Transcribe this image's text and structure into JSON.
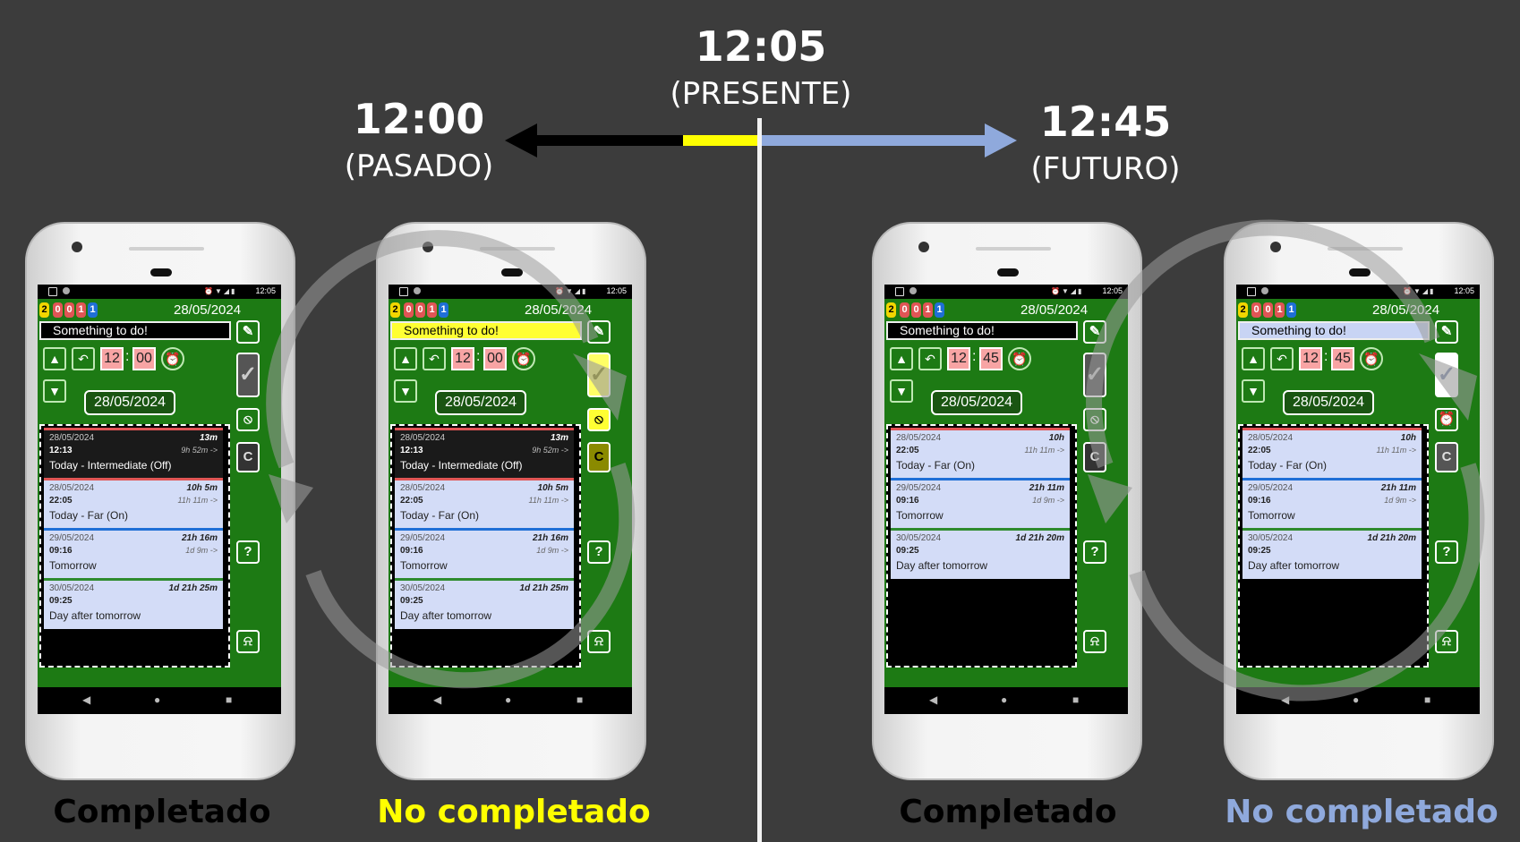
{
  "header": {
    "present_time": "12:05",
    "present_label": "(PRESENTE)",
    "past_time": "12:00",
    "past_label": "(PASADO)",
    "future_time": "12:45",
    "future_label": "(FUTURO)"
  },
  "captions": {
    "c1": "Completado",
    "c2": "No completado",
    "c3": "Completado",
    "c4": "No completado"
  },
  "colors": {
    "background": "#3c3c3c",
    "present_segment": "#ffff00",
    "past_arrow": "#000000",
    "future_arrow": "#8fa9dc",
    "caption_completed": "#000000",
    "caption_past_not_completed": "#ffff00",
    "caption_future_not_completed": "#8fa9dc",
    "app_green": "#1d7a14"
  },
  "status_time": "12:05",
  "badges": [
    "2",
    "0",
    "0",
    "1",
    "1"
  ],
  "header_date": "28/05/2024",
  "task_text": "Something to do!",
  "date_field": "28/05/2024",
  "icons": {
    "up": "arrow-up-icon",
    "undo": "undo-icon",
    "alarm_plus": "alarm-add-icon",
    "down": "arrow-down-icon",
    "edit": "pencil-icon",
    "check": "check-icon",
    "alarm_off": "alarm-off-icon",
    "alarm_on": "alarm-on-icon",
    "clear": "clear-icon",
    "help": "help-icon",
    "mute": "bell-off-icon"
  },
  "phones": [
    {
      "hour": "12",
      "minute": "00",
      "clear_label": "C",
      "help_label": "?",
      "items": [
        {
          "date": "28/05/2024",
          "time": "12:13",
          "name": "Today - Intermediate  (Off)",
          "duration": "13m",
          "remaining": "9h 52m ->"
        },
        {
          "date": "28/05/2024",
          "time": "22:05",
          "name": "Today - Far (On)",
          "duration": "10h 5m",
          "remaining": "11h 11m ->"
        },
        {
          "date": "29/05/2024",
          "time": "09:16",
          "name": "Tomorrow",
          "duration": "21h 16m",
          "remaining": "1d 9m ->"
        },
        {
          "date": "30/05/2024",
          "time": "09:25",
          "name": "Day after tomorrow",
          "duration": "1d 21h 25m",
          "remaining": ""
        }
      ]
    },
    {
      "hour": "12",
      "minute": "00",
      "clear_label": "C",
      "help_label": "?",
      "items": [
        {
          "date": "28/05/2024",
          "time": "12:13",
          "name": "Today - Intermediate  (Off)",
          "duration": "13m",
          "remaining": "9h 52m ->"
        },
        {
          "date": "28/05/2024",
          "time": "22:05",
          "name": "Today - Far (On)",
          "duration": "10h 5m",
          "remaining": "11h 11m ->"
        },
        {
          "date": "29/05/2024",
          "time": "09:16",
          "name": "Tomorrow",
          "duration": "21h 16m",
          "remaining": "1d 9m ->"
        },
        {
          "date": "30/05/2024",
          "time": "09:25",
          "name": "Day after tomorrow",
          "duration": "1d 21h 25m",
          "remaining": ""
        }
      ]
    },
    {
      "hour": "12",
      "minute": "45",
      "clear_label": "C",
      "help_label": "?",
      "items": [
        {
          "date": "28/05/2024",
          "time": "22:05",
          "name": "Today - Far (On)",
          "duration": "10h",
          "remaining": "11h 11m ->"
        },
        {
          "date": "29/05/2024",
          "time": "09:16",
          "name": "Tomorrow",
          "duration": "21h 11m",
          "remaining": "1d 9m ->"
        },
        {
          "date": "30/05/2024",
          "time": "09:25",
          "name": "Day after tomorrow",
          "duration": "1d 21h 20m",
          "remaining": ""
        }
      ]
    },
    {
      "hour": "12",
      "minute": "45",
      "clear_label": "C",
      "help_label": "?",
      "items": [
        {
          "date": "28/05/2024",
          "time": "22:05",
          "name": "Today - Far (On)",
          "duration": "10h",
          "remaining": "11h 11m ->"
        },
        {
          "date": "29/05/2024",
          "time": "09:16",
          "name": "Tomorrow",
          "duration": "21h 11m",
          "remaining": "1d 9m ->"
        },
        {
          "date": "30/05/2024",
          "time": "09:25",
          "name": "Day after tomorrow",
          "duration": "1d 21h 20m",
          "remaining": ""
        }
      ]
    }
  ]
}
